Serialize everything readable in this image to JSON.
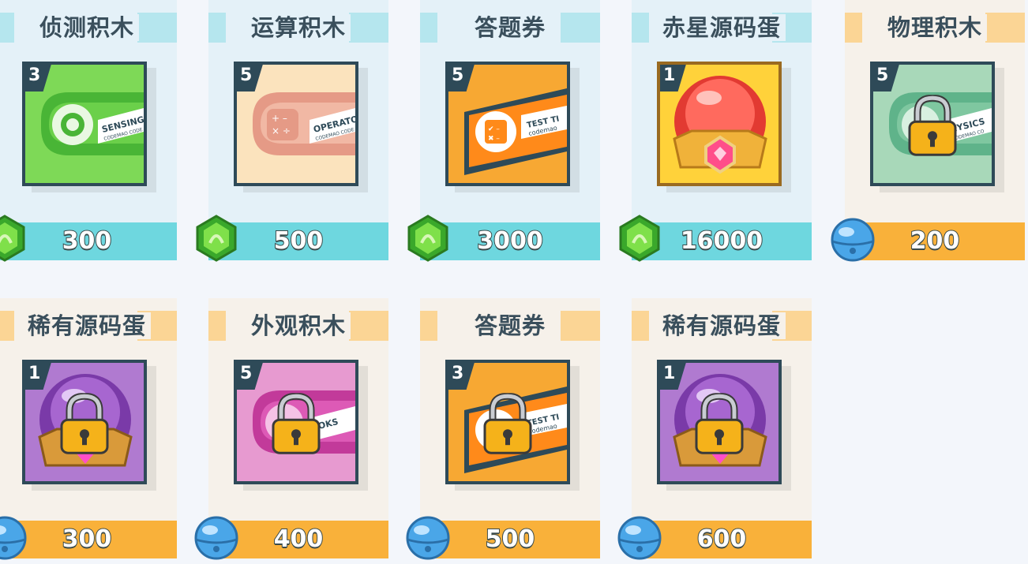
{
  "colors": {
    "blue_card": "#e4f1f8",
    "blue_price": "#6ed7df",
    "cream_card": "#f6f1ea",
    "orange_price": "#f9b13a",
    "frame": "#2e4a58"
  },
  "items": [
    {
      "title": "侦测积木",
      "count": "3",
      "price": "300",
      "theme": "blue",
      "currency_icon": "green-gem-icon",
      "art_icon": "sensing-block-icon",
      "locked": false
    },
    {
      "title": "运算积木",
      "count": "5",
      "price": "500",
      "theme": "blue",
      "currency_icon": "green-gem-icon",
      "art_icon": "operator-block-icon",
      "locked": false
    },
    {
      "title": "答题券",
      "count": "5",
      "price": "3000",
      "theme": "blue",
      "currency_icon": "green-gem-icon",
      "art_icon": "test-ticket-icon",
      "locked": false
    },
    {
      "title": "赤星源码蛋",
      "count": "1",
      "price": "16000",
      "theme": "blue",
      "currency_icon": "green-gem-icon",
      "art_icon": "red-star-egg-icon",
      "locked": false
    },
    {
      "title": "物理积木",
      "count": "5",
      "price": "200",
      "theme": "cream",
      "currency_icon": "blue-bell-icon",
      "art_icon": "physics-block-icon",
      "locked": true
    },
    {
      "title": "稀有源码蛋",
      "count": "1",
      "price": "300",
      "theme": "cream",
      "currency_icon": "blue-bell-icon",
      "art_icon": "rare-egg-icon",
      "locked": true
    },
    {
      "title": "外观积木",
      "count": "5",
      "price": "400",
      "theme": "cream",
      "currency_icon": "blue-bell-icon",
      "art_icon": "looks-block-icon",
      "locked": true
    },
    {
      "title": "答题券",
      "count": "3",
      "price": "500",
      "theme": "cream",
      "currency_icon": "blue-bell-icon",
      "art_icon": "test-ticket-icon",
      "locked": true
    },
    {
      "title": "稀有源码蛋",
      "count": "1",
      "price": "600",
      "theme": "cream",
      "currency_icon": "blue-bell-icon",
      "art_icon": "rare-egg-icon",
      "locked": true
    }
  ],
  "art_text": {
    "sensing": "SENSING",
    "sensing_sub": "CODEMAO CODE",
    "operator": "OPERATO",
    "operator_sub": "CODEMAO CODE",
    "ticket": "TEST TI",
    "ticket_sub": "codemao",
    "physics": "HYSICS",
    "physics_sub": "CODEMAO CO",
    "looks": "OKS"
  }
}
